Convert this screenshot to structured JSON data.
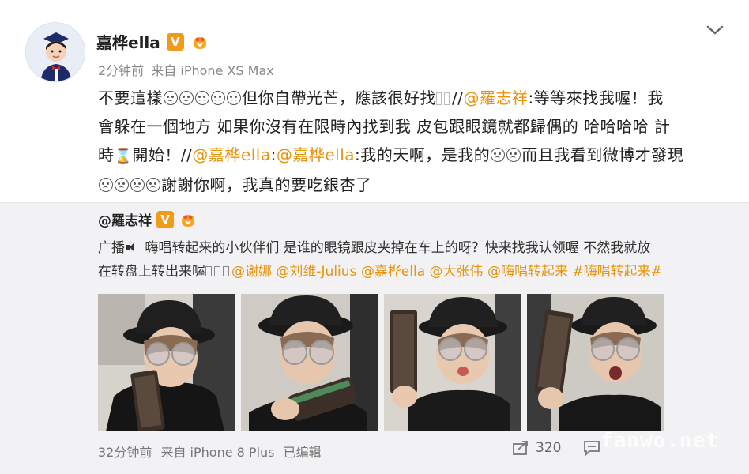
{
  "author": {
    "name": "嘉桦ella",
    "verified_badge": "V",
    "meta_time": "2分钟前",
    "meta_source": "来自 iPhone XS Max"
  },
  "post": {
    "line1_a": "不要這樣",
    "line1_b": "但你自帶光芒，應該很好找",
    "line1_sep": "//",
    "mention1": "@羅志祥",
    "line1_c": ":等等來找我喔！我",
    "line2": "會躲在一個地方 如果你沒有在限時內找到我 皮包跟眼鏡就都歸偶的 哈哈哈哈 計",
    "line3_a": "時",
    "line3_b": "開始！//",
    "mention2": "@嘉桦ella",
    "line3_colon": ":",
    "mention3": "@嘉桦ella",
    "line3_c": ":我的天啊，是我的",
    "line3_d": "而且我看到微博才發現",
    "line4": "謝謝你啊，我真的要吃銀杏了"
  },
  "repost": {
    "author": "@羅志祥",
    "verified_badge": "V",
    "text_a": "广播",
    "text_b": "嗨唱转起来的小伙伴们 是谁的眼镜跟皮夹掉在车上的呀？快来找我认领喔 不然我就放",
    "text_c": "在转盘上转出来喔",
    "mentions": [
      "@谢娜",
      "@刘维-Julius",
      "@嘉桦ella",
      "@大张伟",
      "@嗨唱转起来"
    ],
    "hashtag": "#嗨唱转起来#",
    "photos": [
      "photo-1",
      "photo-2",
      "photo-3",
      "photo-4"
    ],
    "footer_time": "32分钟前",
    "footer_source": "来自 iPhone 8 Plus",
    "footer_edited": "已编辑",
    "share_count": "320"
  },
  "watermark": "fanwo.net",
  "colors": {
    "accent": "#e8940c",
    "badge": "#f29a1a",
    "repost_bg": "#f2f2f5"
  }
}
